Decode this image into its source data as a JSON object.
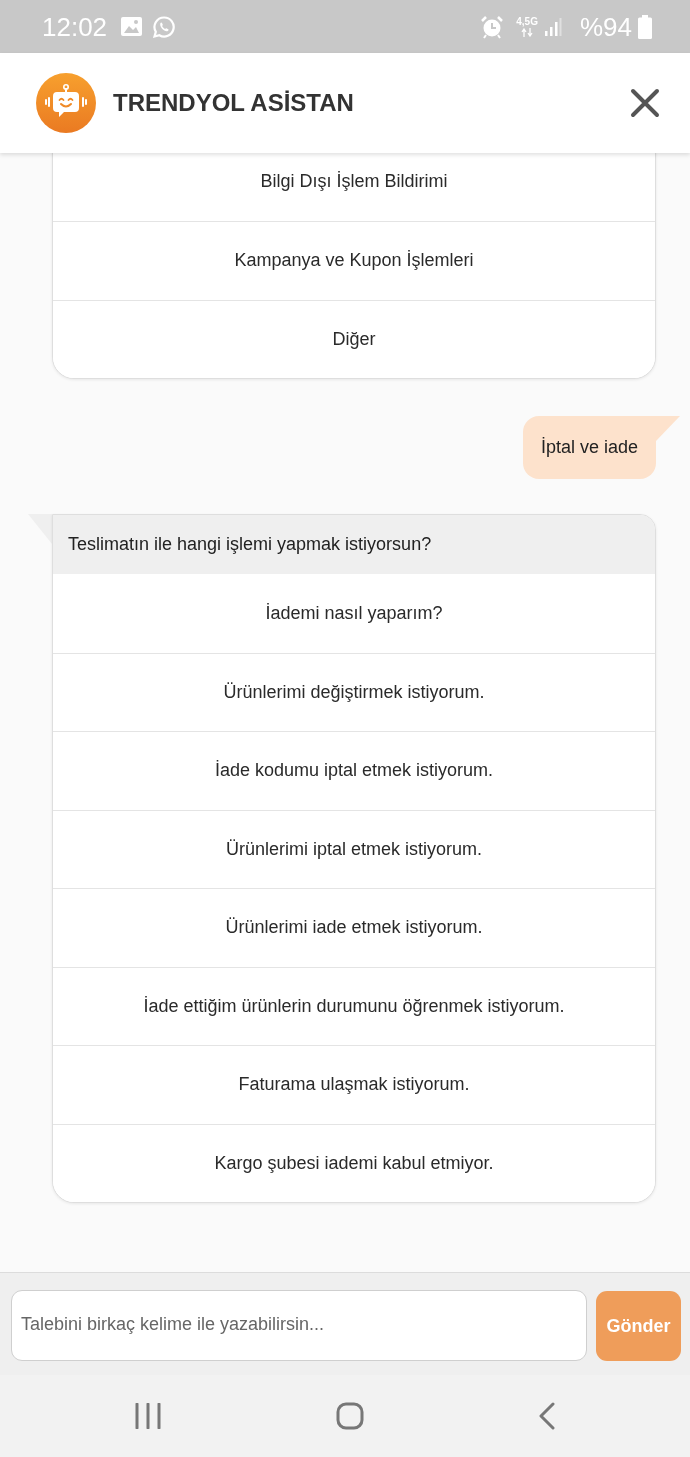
{
  "status_bar": {
    "time": "12:02",
    "network": "4,5G",
    "battery": "%94"
  },
  "header": {
    "title": "TRENDYOL ASİSTAN"
  },
  "messages": [
    {
      "kind": "bot",
      "options": [
        "Bilgi Dışı İşlem Bildirimi",
        "Kampanya ve Kupon İşlemleri",
        "Diğer"
      ]
    },
    {
      "kind": "user",
      "text": "İptal ve iade"
    },
    {
      "kind": "bot",
      "text": "Teslimatın ile hangi işlemi yapmak istiyorsun?",
      "options": [
        "İademi nasıl yaparım?",
        "Ürünlerimi değiştirmek istiyorum.",
        "İade kodumu iptal etmek istiyorum.",
        "Ürünlerimi iptal etmek istiyorum.",
        "Ürünlerimi iade etmek istiyorum.",
        "İade ettiğim ürünlerin durumunu öğrenmek istiyorum.",
        "Faturama ulaşmak istiyorum.",
        "Kargo şubesi iademi kabul etmiyor."
      ]
    }
  ],
  "composer": {
    "placeholder": "Talebini birkaç kelime ile yazabilirsin...",
    "button": "Gönder"
  }
}
